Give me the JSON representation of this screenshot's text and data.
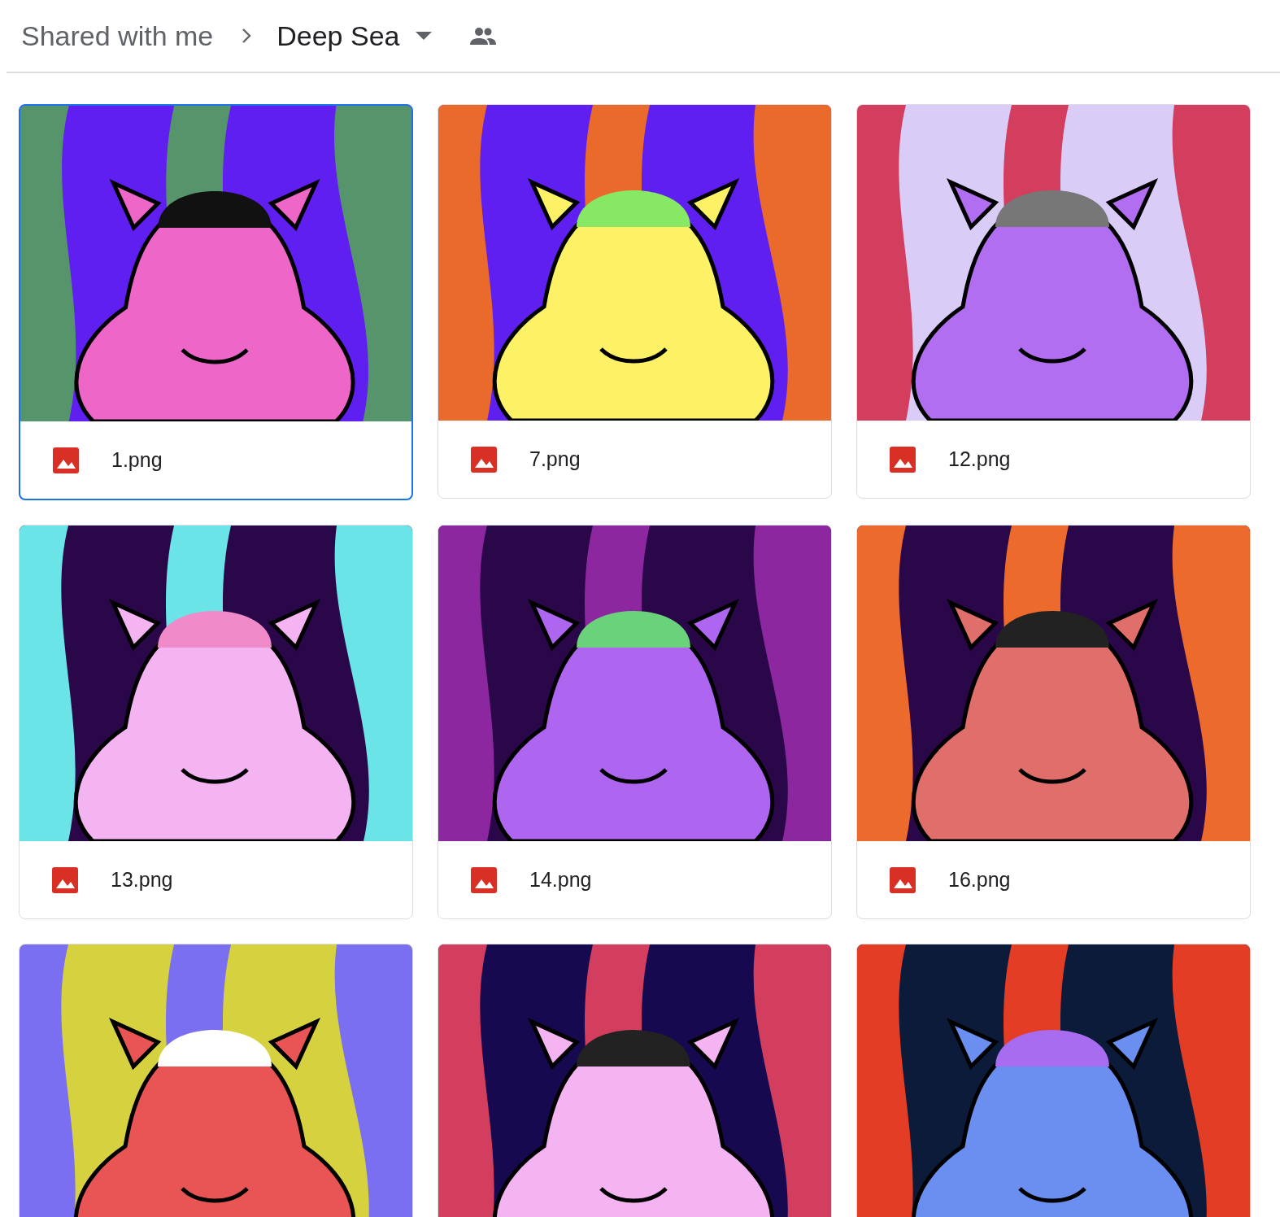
{
  "breadcrumb": {
    "parent": "Shared with me",
    "current": "Deep Sea"
  },
  "files": [
    {
      "name": "1.png",
      "selected": true,
      "kind": "picture"
    },
    {
      "name": "7.png",
      "selected": false,
      "kind": "picture"
    },
    {
      "name": "12.png",
      "selected": false,
      "kind": "picture"
    },
    {
      "name": "13.png",
      "selected": false,
      "kind": "picture"
    },
    {
      "name": "14.png",
      "selected": false,
      "kind": "picture"
    },
    {
      "name": "16.png",
      "selected": false,
      "kind": "picture"
    },
    {
      "kind": "picture",
      "selected": false
    },
    {
      "kind": "picture",
      "selected": false
    },
    {
      "kind": "picture",
      "selected": false
    }
  ]
}
